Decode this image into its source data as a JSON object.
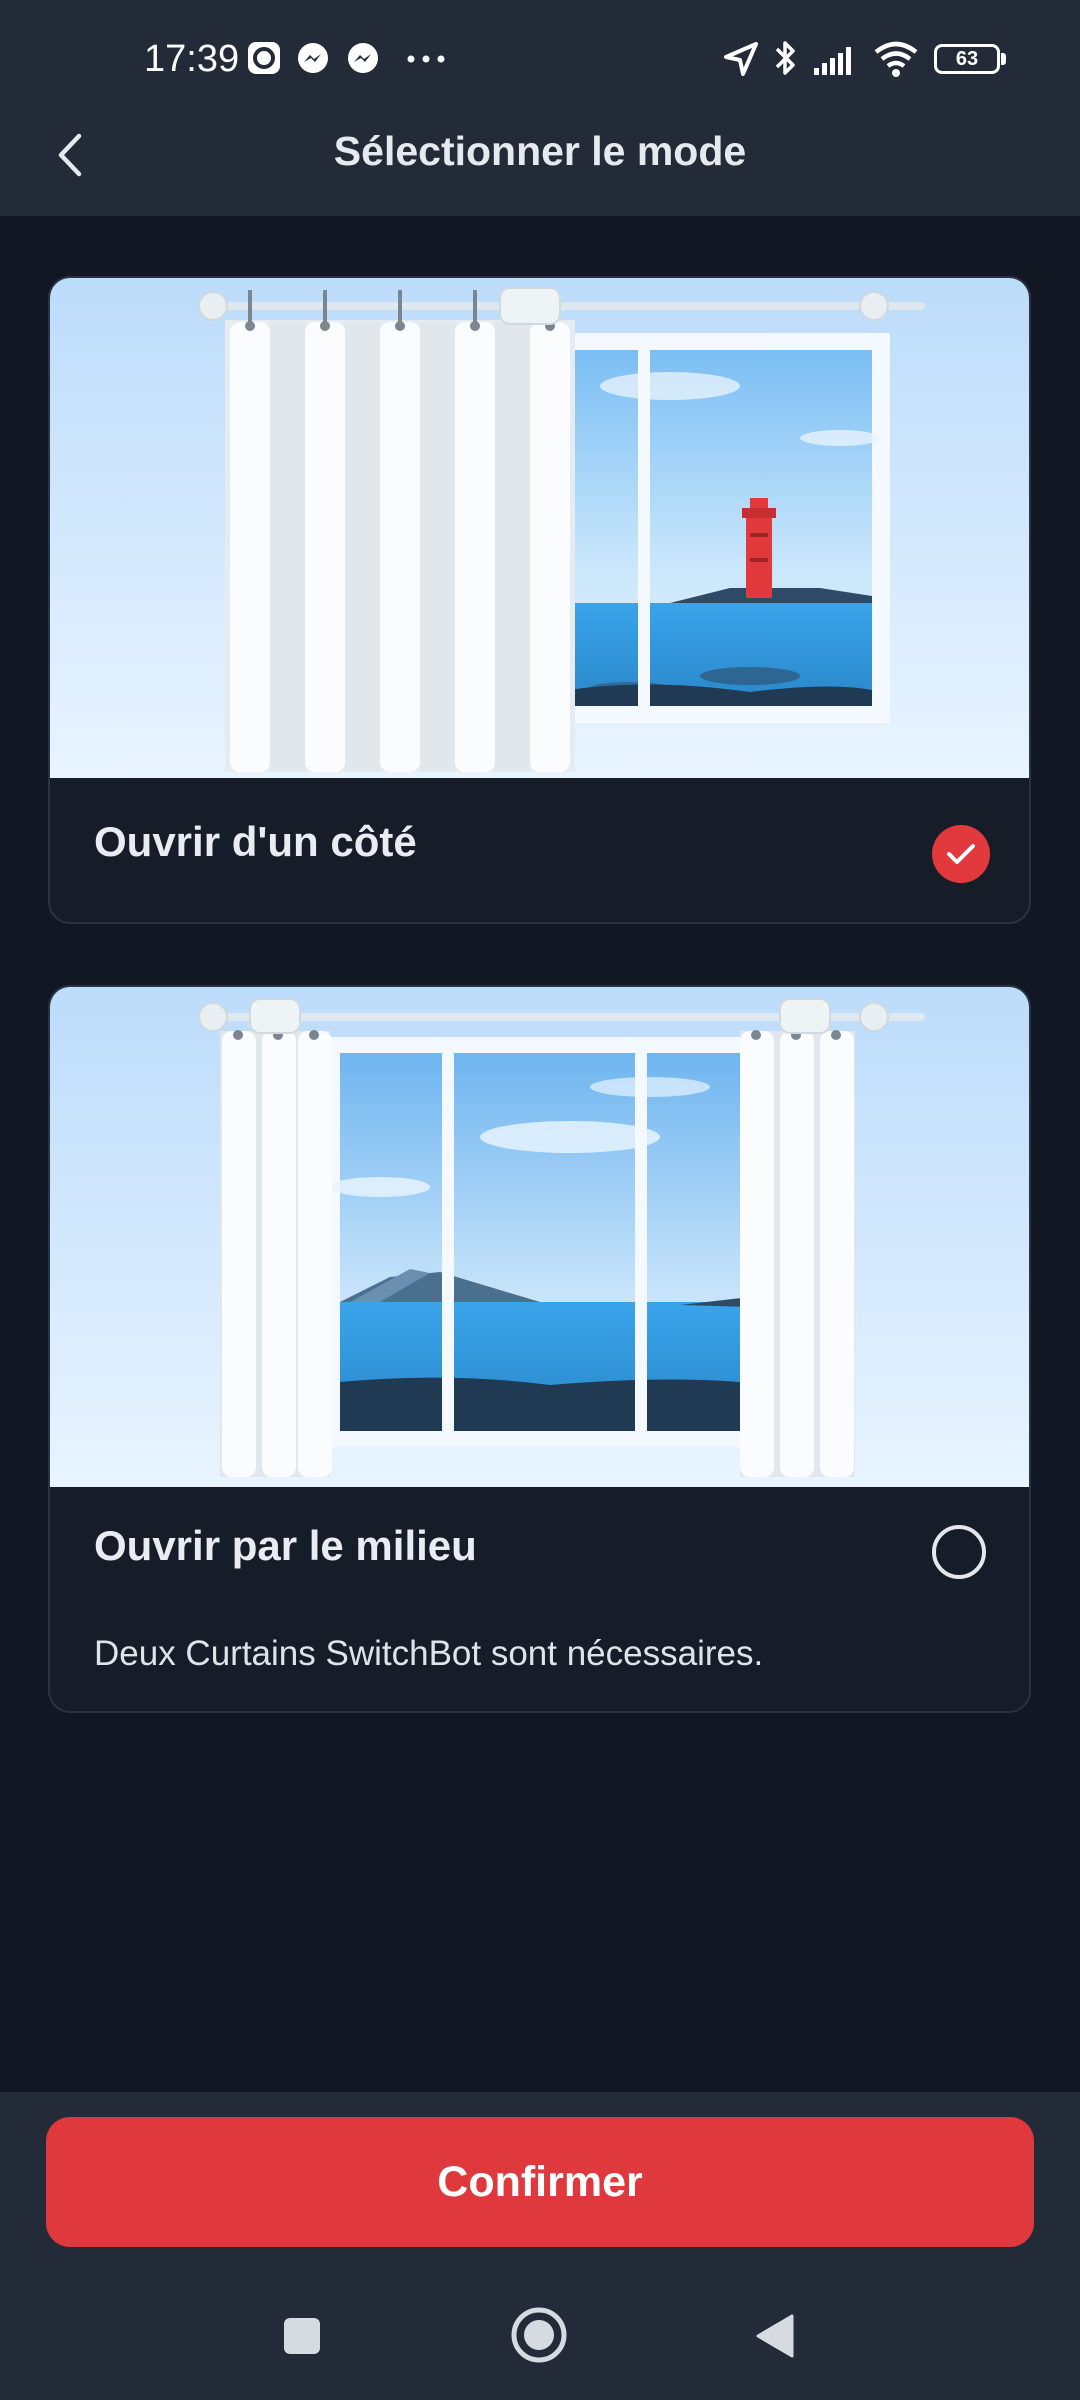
{
  "status_bar": {
    "time": "17:39",
    "battery": "63",
    "icons": [
      "notification-app-icon",
      "messenger-icon",
      "messenger-icon",
      "more-dots-icon",
      "location-arrow-icon",
      "bluetooth-icon",
      "signal-icon",
      "wifi-icon",
      "battery-icon"
    ]
  },
  "header": {
    "title": "Sélectionner le mode",
    "back_icon": "chevron-left-icon"
  },
  "modes": [
    {
      "label": "Ouvrir d'un côté",
      "selected": true,
      "illustration": "curtain-one-side-lighthouse"
    },
    {
      "label": "Ouvrir par le milieu",
      "selected": false,
      "description": "Deux Curtains SwitchBot sont nécessaires.",
      "illustration": "curtain-center-mountain"
    }
  ],
  "footer": {
    "confirm_label": "Confirmer"
  },
  "system_nav": {
    "icons": [
      "recents-square-icon",
      "home-circle-icon",
      "back-triangle-icon"
    ]
  },
  "colors": {
    "accent": "#e0393d",
    "background": "#111823",
    "bar": "#232b38",
    "card": "#161d29"
  }
}
